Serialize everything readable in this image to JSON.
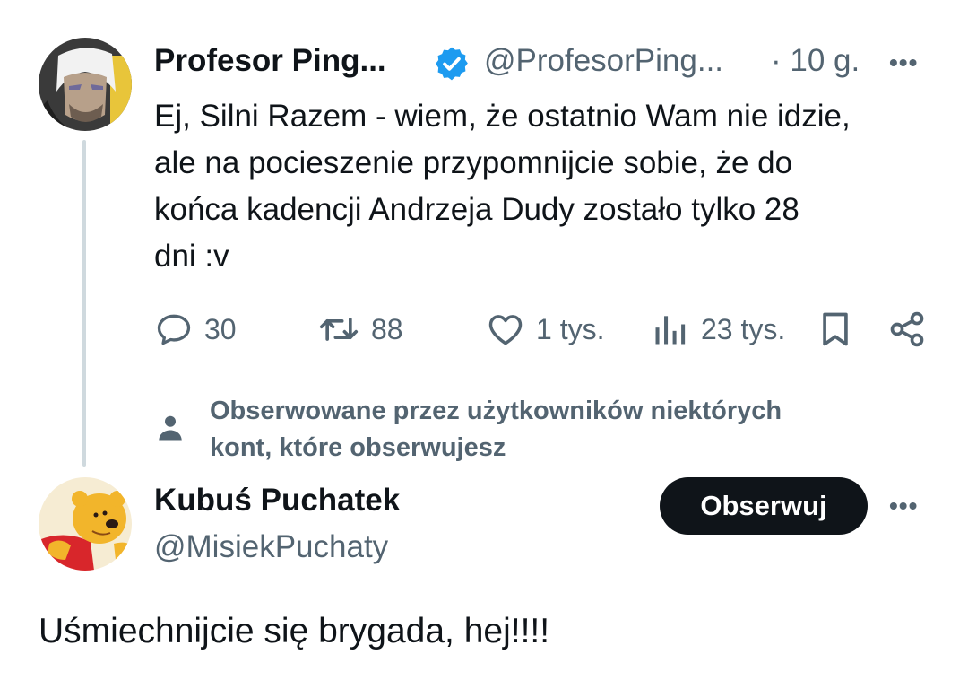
{
  "parent_tweet": {
    "author_name": "Profesor Ping...",
    "handle": "@ProfesorPing...",
    "time": "· 10 g.",
    "more": "•••",
    "verified": true,
    "text": "Ej, Silni Razem - wiem, że ostatnio Wam nie idzie,\nale na pocieszenie przypomnijcie sobie, że do\nkońca kadencji Andrzeja Dudy zostało tylko 28\ndni :v",
    "actions": {
      "replies": "30",
      "retweets": "88",
      "likes": "1 tys.",
      "views": "23 tys."
    }
  },
  "followed_by_note": "Obserwowane przez użytkowników niektórych\nkont, które obserwujesz",
  "reply_tweet": {
    "author_name": "Kubuś Puchatek",
    "handle": "@MisiekPuchaty",
    "follow_label": "Obserwuj",
    "more": "•••",
    "text": "Uśmiechnijcie się brygada, hej!!!!"
  },
  "colors": {
    "text": "#0f1419",
    "secondary": "#536471",
    "verified_badge": "#1d9bf0",
    "follow_button_bg": "#0f1419",
    "thread_line": "#cfd9de"
  }
}
